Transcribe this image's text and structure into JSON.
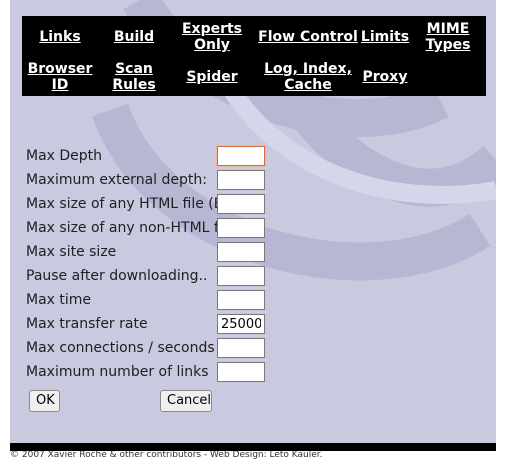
{
  "nav": {
    "links": "Links",
    "build": "Build",
    "experts_only_1": "Experts",
    "experts_only_2": "Only",
    "flow_control": "Flow Control",
    "limits": "Limits",
    "mime_1": "MIME",
    "mime_2": "Types",
    "browser_id_1": "Browser",
    "browser_id_2": "ID",
    "scan_rules_1": "Scan",
    "scan_rules_2": "Rules",
    "spider": "Spider",
    "log_1": "Log, Index,",
    "log_2": "Cache",
    "proxy": "Proxy"
  },
  "form": {
    "fields": [
      {
        "label": "Max Depth",
        "value": ""
      },
      {
        "label": "Maximum external depth:",
        "value": ""
      },
      {
        "label": "Max size of any HTML file (B)",
        "value": ""
      },
      {
        "label": "Max size of any non-HTML file",
        "value": ""
      },
      {
        "label": "Max site size",
        "value": ""
      },
      {
        "label": "Pause after downloading..",
        "value": ""
      },
      {
        "label": "Max time",
        "value": ""
      },
      {
        "label": "Max transfer rate",
        "value": "25000"
      },
      {
        "label": "Max connections / seconds",
        "value": ""
      },
      {
        "label": "Maximum number of links",
        "value": ""
      }
    ],
    "ok_label": "OK",
    "cancel_label": "Cancel"
  },
  "footer": {
    "text": "© 2007 Xavier Roche & other contributors - Web Design: Leto Kauler."
  },
  "colors": {
    "background": "#c9c9e0",
    "nav_bar": "#000000",
    "focus_border": "#d96a3a"
  }
}
